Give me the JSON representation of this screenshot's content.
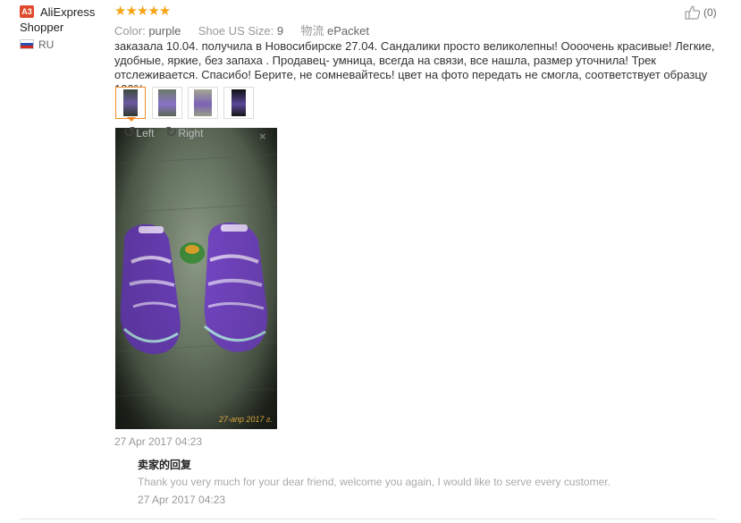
{
  "user": {
    "badge": "A3",
    "name": "AliExpress Shopper",
    "country": "RU"
  },
  "rating": {
    "stars": "★★★★★"
  },
  "attributes": [
    {
      "label": "Color:",
      "value": "purple"
    },
    {
      "label": "Shoe US Size:",
      "value": "9"
    },
    {
      "label": "物流",
      "value": "ePacket"
    }
  ],
  "helpful": {
    "count": "(0)"
  },
  "review": {
    "text": "заказала 10.04. получила в Новосибирске 27.04. Сандалики просто великолепны! Оооочень красивые! Легкие, удобные, яркие, без запаха . Продавец- умница, всегда на связи, все нашла, размер уточнила! Трек отслеживается. Спасибо! Берите, не сомневайтесь! цвет на фото передать не смогла, соответствует образцу 100%",
    "date": "27 Apr 2017 04:23"
  },
  "viewer": {
    "rotate_left": "Left",
    "rotate_right": "Right",
    "close": "×",
    "photo_stamp": "27-апр 2017 г."
  },
  "seller_reply": {
    "title": "卖家的回复",
    "text": "Thank you very much for your dear friend, welcome you again, I would like to serve every customer.",
    "date": "27 Apr 2017 04:23"
  },
  "colors": {
    "star": "#f7a417",
    "accent": "#f08a24",
    "muted": "#999999"
  }
}
